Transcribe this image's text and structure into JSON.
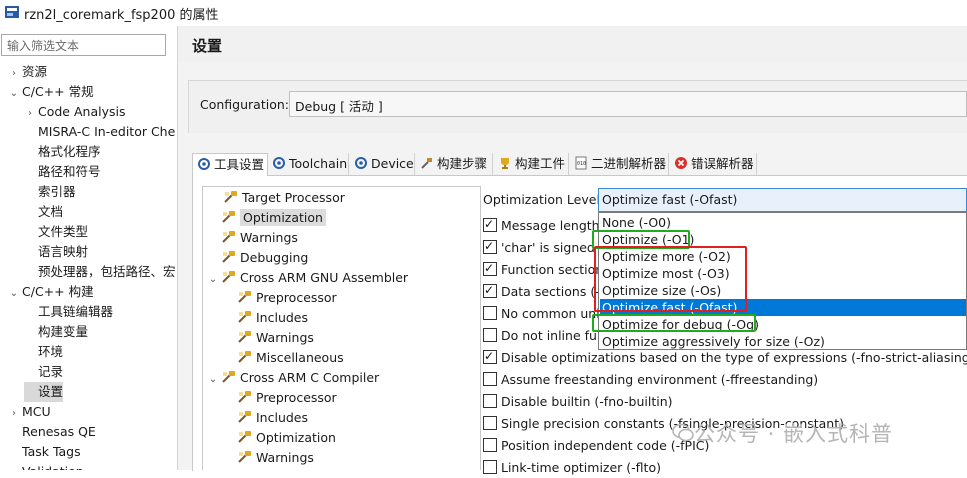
{
  "window": {
    "title": "rzn2l_coremark_fsp200 的属性"
  },
  "filter": {
    "placeholder": "输入筛选文本"
  },
  "left_tree": [
    {
      "label": "资源",
      "chev": "›"
    },
    {
      "label": "C/C++ 常规",
      "chev": "⌄"
    },
    {
      "label": "Code Analysis",
      "chev": "›"
    },
    {
      "label": "MISRA-C In-editor Che",
      "chev": ""
    },
    {
      "label": "格式化程序",
      "chev": ""
    },
    {
      "label": "路径和符号",
      "chev": ""
    },
    {
      "label": "索引器",
      "chev": ""
    },
    {
      "label": "文档",
      "chev": ""
    },
    {
      "label": "文件类型",
      "chev": ""
    },
    {
      "label": "语言映射",
      "chev": ""
    },
    {
      "label": "预处理器，包括路径、宏",
      "chev": ""
    },
    {
      "label": "C/C++ 构建",
      "chev": "⌄"
    },
    {
      "label": "工具链编辑器",
      "chev": ""
    },
    {
      "label": "构建变量",
      "chev": ""
    },
    {
      "label": "环境",
      "chev": ""
    },
    {
      "label": "记录",
      "chev": ""
    },
    {
      "label": "设置",
      "chev": ""
    },
    {
      "label": "MCU",
      "chev": "›"
    },
    {
      "label": "Renesas QE",
      "chev": ""
    },
    {
      "label": "Task Tags",
      "chev": ""
    },
    {
      "label": "Validation",
      "chev": "›"
    }
  ],
  "heading": "设置",
  "configuration": {
    "label": "Configuration:",
    "value": "Debug  [ 活动 ]"
  },
  "tabs": [
    "工具设置",
    "Toolchain",
    "Device",
    "构建步骤",
    "构建工件",
    "二进制解析器",
    "错误解析器"
  ],
  "settings_tree": [
    {
      "label": "Target Processor"
    },
    {
      "label": "Optimization"
    },
    {
      "label": "Warnings"
    },
    {
      "label": "Debugging"
    },
    {
      "label": "Cross ARM GNU Assembler"
    },
    {
      "label": "Preprocessor"
    },
    {
      "label": "Includes"
    },
    {
      "label": "Warnings"
    },
    {
      "label": "Miscellaneous"
    },
    {
      "label": "Cross ARM C Compiler"
    },
    {
      "label": "Preprocessor"
    },
    {
      "label": "Includes"
    },
    {
      "label": "Optimization"
    },
    {
      "label": "Warnings"
    }
  ],
  "optimization": {
    "level_label": "Optimization Level",
    "level_value": "Optimize fast (-Ofast)",
    "options": [
      "None (-O0)",
      "Optimize (-O1)",
      "Optimize more (-O2)",
      "Optimize most (-O3)",
      "Optimize size (-Os)",
      "Optimize fast (-Ofast)",
      "Optimize for debug (-Og)",
      "Optimize aggressively for size (-Oz)"
    ],
    "checkboxes": [
      {
        "label": "Message length",
        "checked": true
      },
      {
        "label": "'char' is signed (",
        "checked": true
      },
      {
        "label": "Function sections",
        "checked": true
      },
      {
        "label": "Data sections (-fd",
        "checked": true
      },
      {
        "label": "No common unin",
        "checked": false
      },
      {
        "label": "Do not inline func",
        "checked": false
      },
      {
        "label": "Disable optimizations based on the type of expressions (-fno-strict-aliasing)",
        "checked": true
      },
      {
        "label": "Assume freestanding environment (-ffreestanding)",
        "checked": false
      },
      {
        "label": "Disable builtin (-fno-builtin)",
        "checked": false
      },
      {
        "label": "Single precision constants (-fsingle-precision-constant)",
        "checked": false
      },
      {
        "label": "Position independent code (-fPIC)",
        "checked": false
      },
      {
        "label": "Link-time optimizer (-flto)",
        "checked": false
      }
    ]
  },
  "watermark": "公众号 · 嵌入式科普",
  "colors": {
    "selection": "#0078d7",
    "green_box": "#1faa1f",
    "red_box": "#e02020"
  }
}
